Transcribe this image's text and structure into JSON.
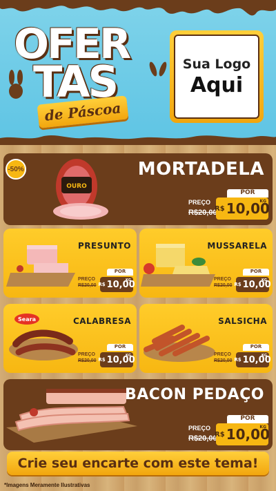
{
  "header": {
    "title_line1": "OFER",
    "title_line2": "TAS",
    "subtitle": "de Páscoa",
    "logo_line1": "Sua Logo",
    "logo_line2": "Aqui"
  },
  "badge": "-50%",
  "products": [
    {
      "name": "MORTADELA",
      "preco_label": "PREÇO",
      "por_label": "POR",
      "old_price": "R$20,00",
      "currency": "R$",
      "new_price": "10,00",
      "unit": "KG",
      "brand": "OURO"
    },
    {
      "name": "PRESUNTO",
      "preco_label": "PREÇO",
      "por_label": "POR",
      "old_price": "R$20,00",
      "currency": "R$",
      "new_price": "10,00",
      "unit": "KG"
    },
    {
      "name": "MUSSARELA",
      "preco_label": "PREÇO",
      "por_label": "POR",
      "old_price": "R$20,00",
      "currency": "R$",
      "new_price": "10,00",
      "unit": "KG"
    },
    {
      "name": "CALABRESA",
      "preco_label": "PREÇO",
      "por_label": "POR",
      "old_price": "R$20,00",
      "currency": "R$",
      "new_price": "10,00",
      "unit": "KG",
      "brand": "Seara"
    },
    {
      "name": "SALSICHA",
      "preco_label": "PREÇO",
      "por_label": "POR",
      "old_price": "R$20,00",
      "currency": "R$",
      "new_price": "10,00",
      "unit": "KG"
    },
    {
      "name": "BACON PEDAÇO",
      "preco_label": "PREÇO",
      "por_label": "POR",
      "old_price": "R$20,00",
      "currency": "R$",
      "new_price": "10,00",
      "unit": "KG"
    }
  ],
  "cta": "Crie seu encarte com este tema!",
  "disclaimer": "*Imagens Meramente Ilustrativas",
  "colors": {
    "brown": "#6b3d1b",
    "yellow": "#f7b712",
    "sky": "#5ec4e4"
  }
}
